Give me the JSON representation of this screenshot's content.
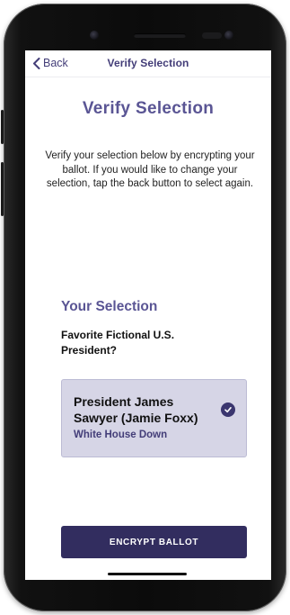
{
  "nav": {
    "back_label": "Back",
    "title": "Verify Selection"
  },
  "page": {
    "title": "Verify Selection",
    "instructions": "Verify your selection below by encrypting your ballot.  If you would like to change your selection, tap the back button to select again."
  },
  "selection": {
    "section_title": "Your Selection",
    "question": "Favorite Fictional U.S. President?",
    "candidate_name": "President James Sawyer (Jamie Foxx)",
    "candidate_subtitle": "White House Down",
    "selected": true
  },
  "actions": {
    "encrypt_label": "ENCRYPT BALLOT"
  },
  "icons": {
    "back": "chevron-left-icon",
    "selected": "check-circle-icon"
  },
  "colors": {
    "accent": "#5a5594",
    "primary_dark": "#322d5f",
    "card_bg": "#d6d5e6"
  }
}
